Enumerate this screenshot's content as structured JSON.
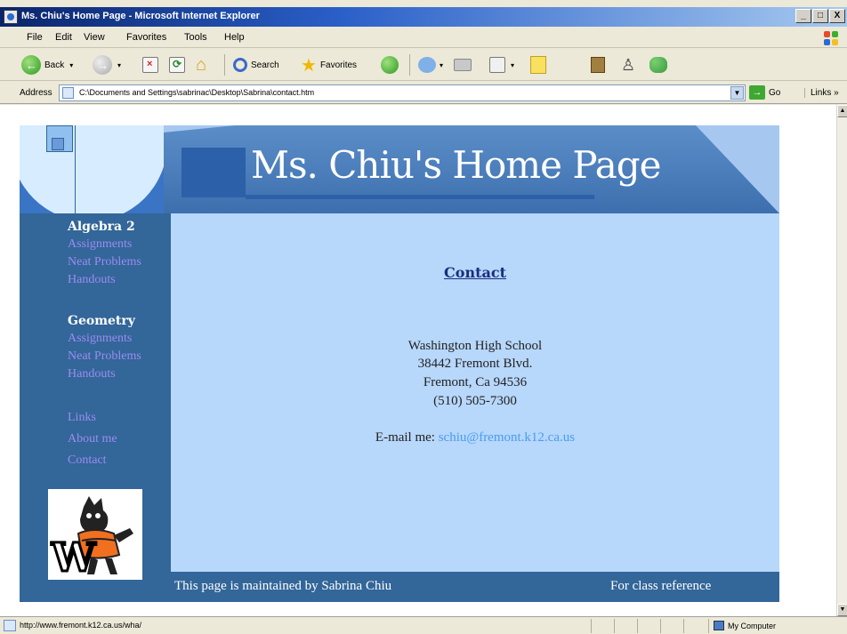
{
  "window": {
    "title": "Ms. Chiu's Home Page - Microsoft Internet Explorer",
    "buttons": {
      "minimize": "_",
      "maximize": "□",
      "close": "X"
    }
  },
  "menu": [
    "File",
    "Edit",
    "View",
    "Favorites",
    "Tools",
    "Help"
  ],
  "toolbar": {
    "back_label": "Back",
    "search_label": "Search",
    "favorites_label": "Favorites"
  },
  "address": {
    "label": "Address",
    "url": "C:\\Documents and Settings\\sabrinac\\Desktop\\Sabrina\\contact.htm",
    "go_label": "Go",
    "links_label": "Links »"
  },
  "page": {
    "banner_title": "Ms. Chiu's Home Page",
    "nav": {
      "algebra": {
        "heading": "Algebra 2",
        "links": [
          "Assignments",
          "Neat Problems",
          "Handouts"
        ]
      },
      "geometry": {
        "heading": "Geometry",
        "links": [
          "Assignments",
          "Neat Problems",
          "Handouts"
        ]
      },
      "misc": [
        "Links",
        "About me",
        "Contact"
      ]
    },
    "mascot_letter": "W",
    "contact": {
      "heading": "Contact",
      "address_lines": [
        "Washington High School",
        "38442 Fremont Blvd.",
        "Fremont, Ca 94536",
        "(510) 505-7300"
      ],
      "email_prefix": "E-mail me:",
      "email": "schiu@fremont.k12.ca.us"
    },
    "footer": {
      "left": "This page is maintained by Sabrina Chiu",
      "right": "For class reference"
    }
  },
  "status": {
    "url": "http://www.fremont.k12.ca.us/wha/",
    "zone": "My Computer"
  },
  "colors": {
    "page_dark": "#336699",
    "page_light": "#b7d7fb",
    "nav_link": "#9b8cf0",
    "email_link": "#4a9cf2"
  }
}
